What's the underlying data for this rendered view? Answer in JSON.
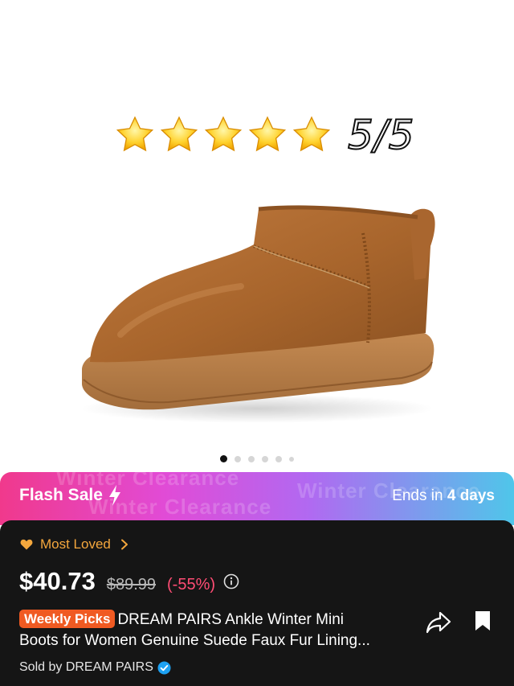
{
  "product_image": {
    "rating_text": "5/5",
    "rating_stars": 5,
    "carousel": {
      "total": 6,
      "current": 1
    }
  },
  "flash_sale": {
    "title": "Flash Sale",
    "ends_prefix": "Ends in",
    "ends_value": "4 days",
    "watermark": "Winter Clearance"
  },
  "product": {
    "most_loved": "Most Loved",
    "price": "$40.73",
    "original_price": "$89.99",
    "discount": "(-55%)",
    "badge": "Weekly Picks",
    "title_line1": "DREAM PAIRS Ankle Winter Mini",
    "title_line2": "Boots for Women Genuine Suede Faux Fur Lining...",
    "seller": "Sold by DREAM PAIRS"
  },
  "colors": {
    "accent_orange": "#f05a22",
    "most_loved": "#f4a73d",
    "discount": "#ff4d74",
    "panel_bg": "#151515",
    "verified": "#1da1f2"
  },
  "icons": [
    "star-icon",
    "lightning-bolt-icon",
    "heart-icon",
    "chevron-right-icon",
    "info-icon",
    "share-icon",
    "bookmark-icon",
    "verified-badge-icon"
  ]
}
